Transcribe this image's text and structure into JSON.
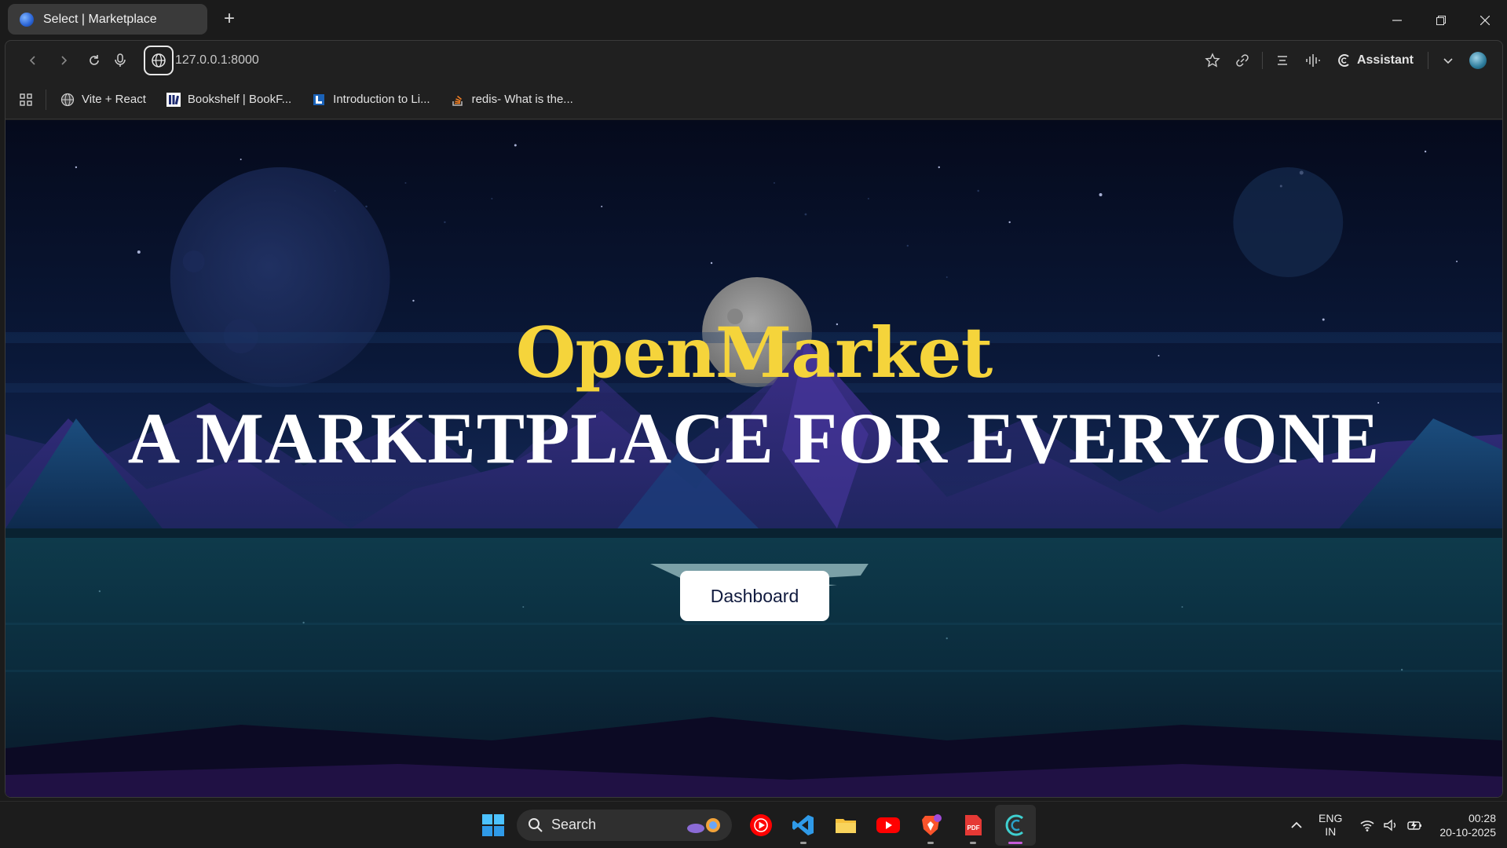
{
  "browser": {
    "tab_title": "Select | Marketplace",
    "url": "127.0.0.1:8000",
    "assistant_label": "Assistant",
    "bookmarks": [
      {
        "label": "Vite + React",
        "icon": "globe-icon"
      },
      {
        "label": "Bookshelf | BookF...",
        "icon": "bookshelf-favicon"
      },
      {
        "label": "Introduction to Li...",
        "icon": "linode-favicon"
      },
      {
        "label": "redis- What is the...",
        "icon": "stackoverflow-favicon"
      }
    ]
  },
  "page": {
    "brand": "OpenMarket",
    "tagline": "A MARKETPLACE FOR EVERYONE",
    "cta_label": "Dashboard",
    "colors": {
      "brand": "#f5d43b",
      "tagline": "#ffffff",
      "cta_bg": "#ffffff",
      "cta_text": "#101a3e"
    }
  },
  "taskbar": {
    "search_label": "Search",
    "apps": [
      "youtube-music-icon",
      "vscode-icon",
      "file-explorer-icon",
      "youtube-icon",
      "brave-icon",
      "pdf-reader-icon",
      "browser-icon"
    ],
    "language": {
      "line1": "ENG",
      "line2": "IN"
    },
    "time": "00:28",
    "date": "20-10-2025"
  }
}
